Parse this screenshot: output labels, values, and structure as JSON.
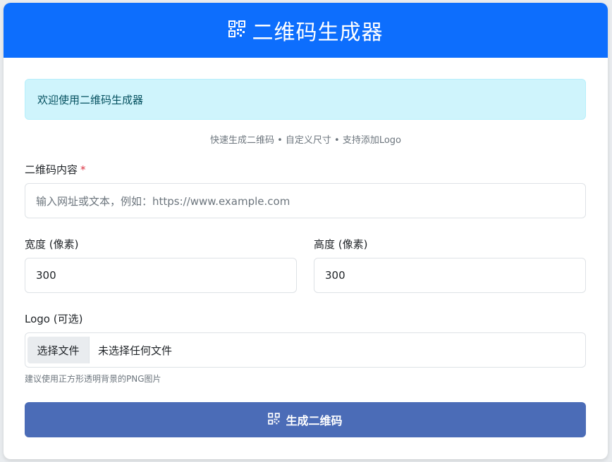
{
  "header": {
    "title": "二维码生成器",
    "icon": "qrcode-icon"
  },
  "alert": {
    "text": "欢迎使用二维码生成器"
  },
  "subtitle": "快速生成二维码 • 自定义尺寸 • 支持添加Logo",
  "form": {
    "content": {
      "label": "二维码内容",
      "required_mark": "*",
      "placeholder": "输入网址或文本，例如：https://www.example.com"
    },
    "width": {
      "label": "宽度 (像素)",
      "value": "300"
    },
    "height": {
      "label": "高度 (像素)",
      "value": "300"
    },
    "logo": {
      "label_main": "Logo",
      "label_optional": "(可选)",
      "button_label": "选择文件",
      "status": "未选择任何文件",
      "help": "建议使用正方形透明背景的PNG图片"
    },
    "submit": {
      "label": "生成二维码",
      "icon": "qrcode-icon"
    }
  },
  "colors": {
    "header_bg": "#0d6efd",
    "alert_bg": "#cff4fc",
    "alert_text": "#055160",
    "submit_bg": "#4b6cb7",
    "required": "#dc3545"
  }
}
